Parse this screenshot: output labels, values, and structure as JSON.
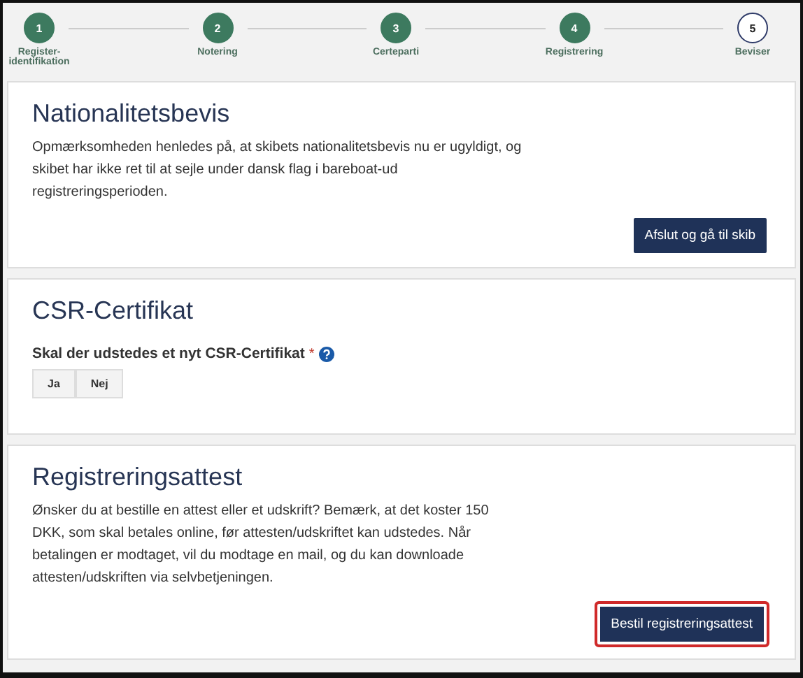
{
  "steps": [
    {
      "number": "1",
      "label": "Register-identifikation",
      "completed": true
    },
    {
      "number": "2",
      "label": "Notering",
      "completed": true
    },
    {
      "number": "3",
      "label": "Certeparti",
      "completed": true
    },
    {
      "number": "4",
      "label": "Registrering",
      "completed": true
    },
    {
      "number": "5",
      "label": "Beviser",
      "completed": false
    }
  ],
  "sections": [
    {
      "kind": "info",
      "title": "Nationalitetsbevis",
      "text": "Opmærksomheden henledes på, at skibets nationalitetsbevis nu er ugyldigt, og skibet har ikke ret til at sejle under dansk flag i bareboat-ud registreringsperioden.",
      "button": {
        "label": "Afslut og gå til skib",
        "highlighted": false
      }
    },
    {
      "kind": "question",
      "title": "CSR-Certifikat",
      "question": "Skal der udstedes et nyt CSR-Certifikat",
      "required_mark": "*",
      "options": [
        {
          "label": "Ja",
          "selected": false
        },
        {
          "label": "Nej",
          "selected": false
        }
      ]
    },
    {
      "kind": "info",
      "title": "Registreringsattest",
      "text": "Ønsker du at bestille en attest eller et udskrift? Bemærk, at det koster 150 DKK, som skal betales online, før attesten/udskriftet kan udstedes. Når betalingen er modtaget, vil du modtage en mail, og du kan downloade attesten/udskriften via selvbetjeningen.",
      "button": {
        "label": "Bestil registreringsattest",
        "highlighted": true
      }
    }
  ]
}
